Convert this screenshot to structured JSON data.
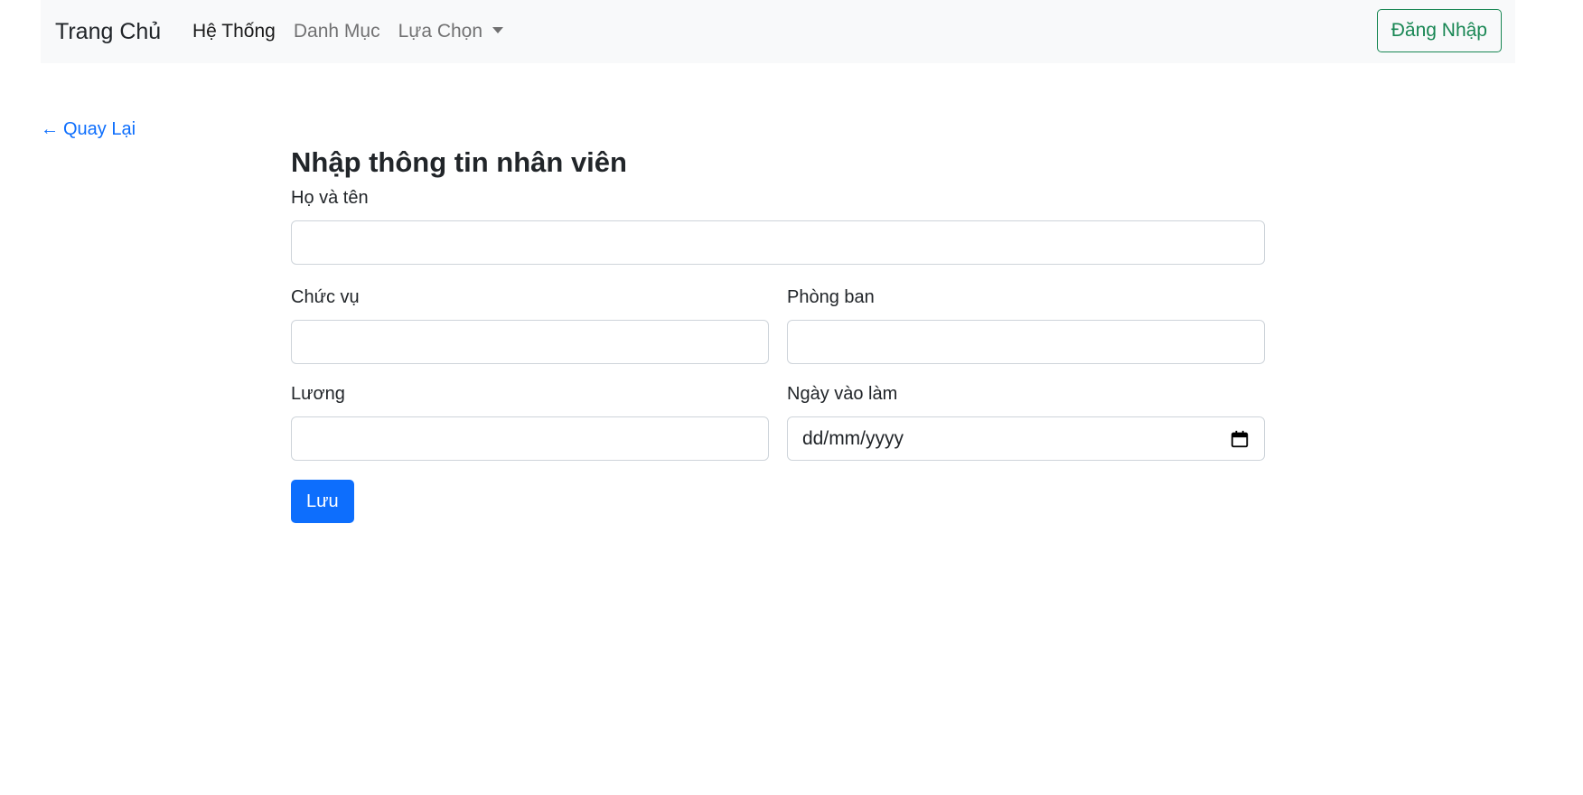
{
  "navbar": {
    "brand": "Trang Chủ",
    "links": [
      {
        "label": "Hệ Thống"
      },
      {
        "label": "Danh Mục"
      },
      {
        "label": "Lựa Chọn"
      }
    ],
    "login_label": "Đăng Nhập"
  },
  "back_link": {
    "arrow": "←",
    "label": "Quay Lại"
  },
  "form": {
    "title": "Nhập thông tin nhân viên",
    "fields": {
      "full_name": {
        "label": "Họ và tên",
        "value": ""
      },
      "position": {
        "label": "Chức vụ",
        "value": ""
      },
      "department": {
        "label": "Phòng ban",
        "value": ""
      },
      "salary": {
        "label": "Lương",
        "value": ""
      },
      "start_date": {
        "label": "Ngày vào làm",
        "placeholder": "dd/mm/yyyy"
      }
    },
    "save_label": "Lưu"
  },
  "colors": {
    "primary": "#0d6efd",
    "success": "#198754",
    "navbar_bg": "#f8f9fa",
    "border": "#ced4da"
  },
  "icons": {
    "calendar": "calendar-icon",
    "dropdown": "chevron-down-icon"
  }
}
